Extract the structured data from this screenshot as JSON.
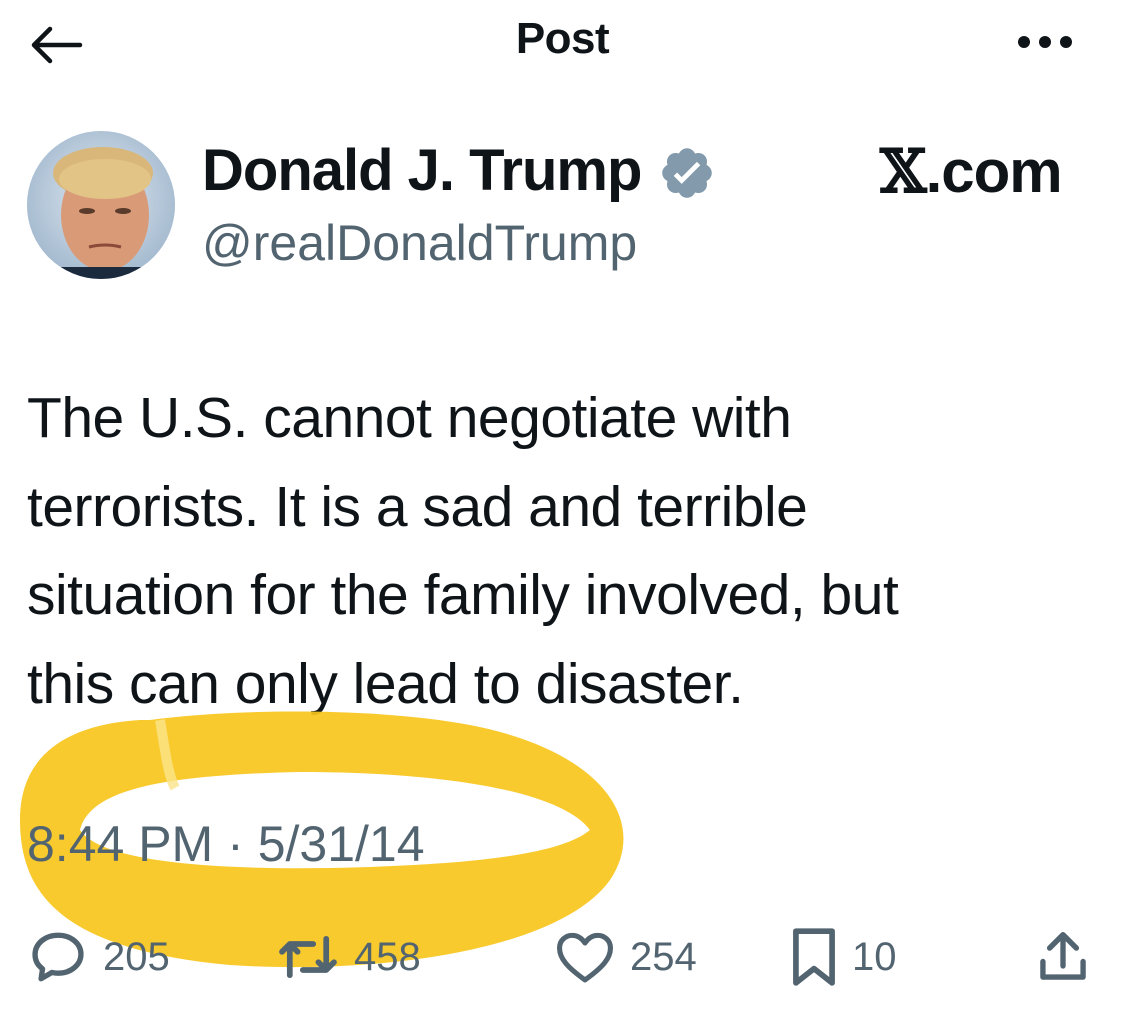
{
  "header": {
    "back_icon": "arrow-left-icon",
    "title": "Post",
    "more_icon": "more-horizontal-icon"
  },
  "author": {
    "name": "Donald J. Trump",
    "handle": "@realDonaldTrump",
    "verified": true,
    "avatar_icon": "avatar"
  },
  "watermark": {
    "x": "𝕏",
    "text": ".com"
  },
  "post": {
    "text": "The U.S. cannot negotiate with\nterrorists. It is a sad and terrible\nsituation for the family involved, but\nthis can only lead to disaster.",
    "time": "8:44 PM",
    "separator": "·",
    "date": "5/31/14"
  },
  "actions": {
    "replies": "205",
    "reposts": "458",
    "likes": "254",
    "bookmarks": "10",
    "share_icon": "share-icon"
  },
  "colors": {
    "text": "#0f1419",
    "muted": "#536471",
    "highlight": "#f7c51b"
  }
}
